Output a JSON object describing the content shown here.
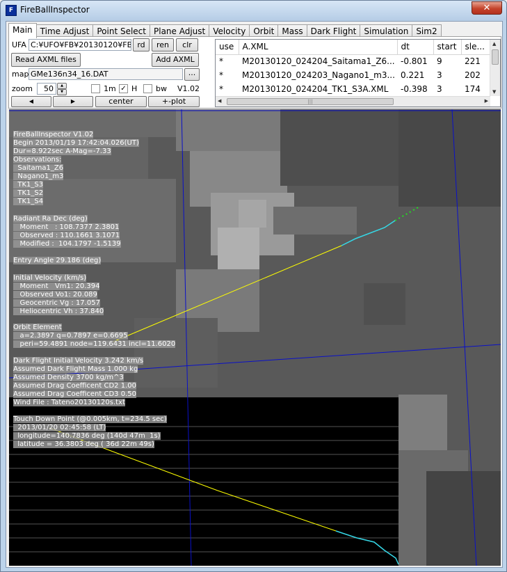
{
  "window": {
    "title": "FireBallInspector",
    "close": "✕"
  },
  "tabs": [
    "Main",
    "Time Adjust",
    "Point Select",
    "Plane Adjust",
    "Velocity",
    "Orbit",
    "Mass",
    "Dark Flight",
    "Simulation",
    "Sim2"
  ],
  "controls": {
    "ufa_label": "UFA",
    "ufa_value": "C:¥UFO¥FB¥20130120¥FB",
    "rd": "rd",
    "ren": "ren",
    "clr": "clr",
    "read_axml": "Read AXML files",
    "add_axml": "Add AXML",
    "map_label": "map",
    "map_value": "GMe136n34_16.DAT",
    "browse": "...",
    "zoom_label": "zoom",
    "zoom_value": "50",
    "cb_1m": "1m",
    "cb_h": "H",
    "cb_bw": "bw",
    "cb_1m_checked": false,
    "cb_h_checked": true,
    "cb_bw_checked": false,
    "check_mark": "✓",
    "version": "V1.02",
    "center": "center",
    "plot": "+-plot",
    "arrow_left": "◀",
    "arrow_right": "▶",
    "spin_up": "▲",
    "spin_down": "▼"
  },
  "grid": {
    "headers": [
      "use",
      "A.XML",
      "dt",
      "start",
      "sle..."
    ],
    "rows": [
      [
        "*",
        "M20130120_024204_Saitama1_Z6...",
        "-0.801",
        "9",
        "221"
      ],
      [
        "*",
        "M20130120_024203_Nagano1_m3...",
        "0.221",
        "3",
        "202"
      ],
      [
        "*",
        "M20130120_024204_TK1_S3A.XML",
        "-0.398",
        "3",
        "174"
      ]
    ],
    "scroll_up": "▲",
    "scroll_down": "▼",
    "scroll_left": "◀",
    "scroll_right": "▶",
    "thumb": "|||"
  },
  "overlay": {
    "info": [
      "FireBallInspector V1.02",
      "Begin 2013/01/19 17:42:04.026(UT)",
      "Dur=8.922sec A-Mag=-7.33",
      "Observations:",
      "  Saitama1_Z6",
      "  Nagano1_m3",
      "  TK1_S3",
      "  TK1_S2",
      "  TK1_S4"
    ],
    "radiant": [
      "Radiant Ra Dec (deg)",
      "   Moment   : 108.7377 2.3801",
      "   Observed : 110.1661 3.1071",
      "   Modified :  104.1797 -1.5139"
    ],
    "entry": [
      "Entry Angle 29.186 (deg)"
    ],
    "velocity": [
      "Initial Velocity (km/s)",
      "   Moment   Vm1: 20.394",
      "   Observed Vo1: 20.089",
      "   Geocentric Vg : 17.057",
      "   Heliocentric Vh : 37.840"
    ],
    "orbit": [
      "Orbit Element",
      "   a=2.3897 q=0.7897 e=0.6695",
      "   peri=59.4891 node=119.6431 incl=11.6020"
    ],
    "dark": [
      "Dark Flight Initial Velocity 3.242 km/s",
      "Assumed Dark Flight Mass 1.000 kg",
      "Assumed Density 3700 kg/m^3",
      "Assumed Drag Coefficent CD2 1.00",
      "Assumed Drag Coefficent CD3 0.50",
      "Wind File : Tateno20130120s.txt"
    ],
    "touch": [
      "Touch Down Point (@0.005km, t=234.5 sec)",
      "  2013/01/20 02:45:58 (LT)",
      "  longitude=140.7836 deg (140d 47m  1s)",
      "  latitude = 36.3803 deg ( 36d 22m 49s)"
    ]
  }
}
